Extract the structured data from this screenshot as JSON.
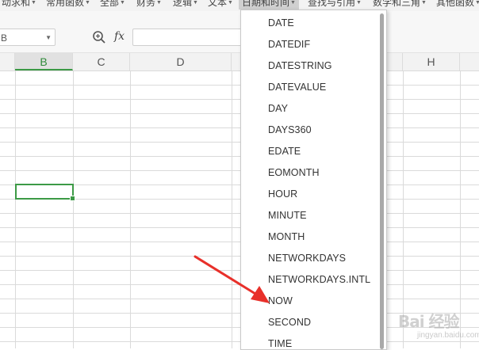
{
  "ribbon": {
    "categories": [
      "动求和",
      "常用函数",
      "全部",
      "财务",
      "逻辑",
      "文本",
      "日期和时间",
      "查找与引用",
      "数学和三角",
      "其他函数"
    ],
    "active_index": 6
  },
  "formula_bar": {
    "name_box_value": "B",
    "fx_label": "fx",
    "formula_value": ""
  },
  "columns": [
    "B",
    "C",
    "D",
    "H"
  ],
  "selected_column": "B",
  "dropdown": {
    "items": [
      "DATE",
      "DATEDIF",
      "DATESTRING",
      "DATEVALUE",
      "DAY",
      "DAYS360",
      "EDATE",
      "EOMONTH",
      "HOUR",
      "MINUTE",
      "MONTH",
      "NETWORKDAYS",
      "NETWORKDAYS.INTL",
      "NOW",
      "SECOND",
      "TIME"
    ]
  },
  "annotation_color": "#e8302a",
  "accent_color": "#3c9a46",
  "watermark": {
    "text": "Bai 经验",
    "url": "jingyan.baidu.com"
  }
}
